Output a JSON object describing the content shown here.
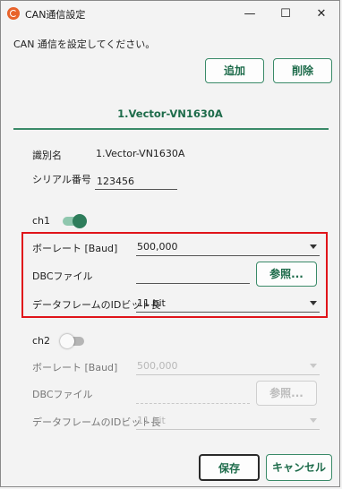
{
  "window": {
    "title": "CAN通信設定",
    "minimize_glyph": "—",
    "maximize_glyph": "☐",
    "close_glyph": "✕"
  },
  "instruction": "CAN 通信を設定してください。",
  "toolbar": {
    "add_label": "追加",
    "delete_label": "削除"
  },
  "tab": {
    "label": "1.Vector-VN1630A"
  },
  "device": {
    "id_label": "識別名",
    "id_value": "1.Vector-VN1630A",
    "serial_label": "シリアル番号",
    "serial_value": "123456"
  },
  "ch1": {
    "label": "ch1",
    "enabled": true,
    "baudrate_label": "ボーレート [Baud]",
    "baudrate_value": "500,000",
    "dbc_label": "DBCファイル",
    "dbc_value": "",
    "browse_label": "参照...",
    "id_bits_label": "データフレームのIDビット長",
    "id_bits_value": "11 bit"
  },
  "ch2": {
    "label": "ch2",
    "enabled": false,
    "baudrate_label": "ボーレート [Baud]",
    "baudrate_value": "500,000",
    "dbc_label": "DBCファイル",
    "dbc_value": "",
    "browse_label": "参照...",
    "id_bits_label": "データフレームのIDビット長",
    "id_bits_value": "11 bit"
  },
  "footer": {
    "save_label": "保存",
    "cancel_label": "キャンセル"
  },
  "colors": {
    "accent": "#1d6b4a",
    "highlight": "#e0141a"
  }
}
